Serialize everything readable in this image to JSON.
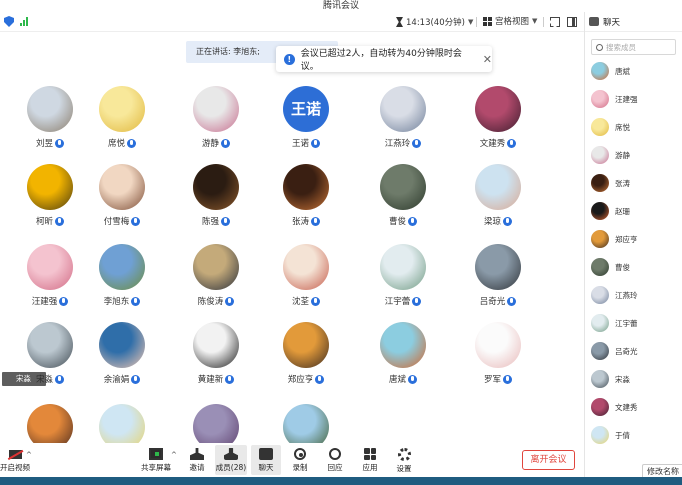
{
  "window": {
    "title": "腾讯会议"
  },
  "topbar": {
    "timer": "14:13(40分钟)",
    "view_label": "宫格视图"
  },
  "speaking": {
    "label": "正在讲话:",
    "speaker": "李旭东;"
  },
  "notice": {
    "text": "会议已超过2人，自动转为40分钟限时会议。",
    "close": "✕"
  },
  "grid": [
    {
      "name": "刘昱",
      "avatar": "photo",
      "colors": [
        "#cfd8e2",
        "#8a7d6b"
      ]
    },
    {
      "name": "席悦",
      "avatar": "photo",
      "colors": [
        "#f8e89a",
        "#e0b73d"
      ]
    },
    {
      "name": "游静",
      "avatar": "photo",
      "colors": [
        "#e8e8e8",
        "#c76c8d"
      ]
    },
    {
      "name": "王诺",
      "avatar": "text",
      "initials": "王诺",
      "host": true
    },
    {
      "name": "江燕玲",
      "avatar": "photo",
      "colors": [
        "#d9dde6",
        "#6f7f99"
      ]
    },
    {
      "name": "文建秀",
      "avatar": "photo",
      "colors": [
        "#b24a6c",
        "#3d1d2e"
      ]
    },
    {
      "name": "柯昕",
      "avatar": "photo",
      "colors": [
        "#f2b400",
        "#4a3a10"
      ]
    },
    {
      "name": "付雪梅",
      "avatar": "photo",
      "colors": [
        "#f1d7c2",
        "#7b4b34"
      ]
    },
    {
      "name": "陈强",
      "avatar": "photo",
      "colors": [
        "#2b1c12",
        "#8d5a2c"
      ]
    },
    {
      "name": "张涛",
      "avatar": "photo",
      "colors": [
        "#3a1f12",
        "#c87336"
      ]
    },
    {
      "name": "曹俊",
      "avatar": "photo",
      "colors": [
        "#6e7b6a",
        "#2d3a2c"
      ]
    },
    {
      "name": "梁琼",
      "avatar": "photo",
      "colors": [
        "#cde2f0",
        "#d9a892"
      ]
    },
    {
      "name": "汪建强",
      "avatar": "photo",
      "colors": [
        "#f4c3cf",
        "#d16a84"
      ]
    },
    {
      "name": "李旭东",
      "avatar": "photo",
      "colors": [
        "#6fa0d4",
        "#6e8d3c"
      ]
    },
    {
      "name": "陈俊涛",
      "avatar": "photo",
      "colors": [
        "#c4aa7a",
        "#2a2f3a"
      ]
    },
    {
      "name": "沈荃",
      "avatar": "photo",
      "colors": [
        "#f4e3d5",
        "#c55b4a"
      ]
    },
    {
      "name": "江宇蕾",
      "avatar": "photo",
      "colors": [
        "#e2ecef",
        "#6f9a82"
      ]
    },
    {
      "name": "吕奇光",
      "avatar": "photo",
      "colors": [
        "#8a9aa8",
        "#2f3338"
      ]
    },
    {
      "name": "宋淼",
      "avatar": "photo",
      "colors": [
        "#bcc8d0",
        "#404a52"
      ]
    },
    {
      "name": "余渝娟",
      "avatar": "photo",
      "colors": [
        "#2f6ea9",
        "#f0c7b2"
      ]
    },
    {
      "name": "黄建新",
      "avatar": "photo",
      "colors": [
        "#f2f2f2",
        "#1a1a1a"
      ]
    },
    {
      "name": "郑应亨",
      "avatar": "photo",
      "colors": [
        "#e29a3a",
        "#3b2a20"
      ]
    },
    {
      "name": "唐斌",
      "avatar": "photo",
      "colors": [
        "#8ccde0",
        "#d2652c"
      ]
    },
    {
      "name": "罗军",
      "avatar": "photo",
      "colors": [
        "#fbfbfb",
        "#e8b8b8"
      ]
    },
    {
      "name": "",
      "avatar": "photo",
      "colors": [
        "#e3883a",
        "#4a2a1e"
      ]
    },
    {
      "name": "",
      "avatar": "photo",
      "colors": [
        "#cfe6f3",
        "#e7d36a"
      ]
    },
    {
      "name": "",
      "avatar": "photo",
      "colors": [
        "#9a8fb6",
        "#5d3f6c"
      ]
    },
    {
      "name": "",
      "avatar": "photo",
      "colors": [
        "#9fcbe6",
        "#3e5b2e"
      ]
    }
  ],
  "self_tile": {
    "name": "宋淼"
  },
  "sidebar": {
    "header": "聊天",
    "search_placeholder": "搜索成员",
    "members": [
      {
        "name": "唐斌",
        "colors": [
          "#8ccde0",
          "#d2652c"
        ]
      },
      {
        "name": "汪建强",
        "colors": [
          "#f4c3cf",
          "#d16a84"
        ]
      },
      {
        "name": "席悦",
        "colors": [
          "#f8e89a",
          "#e0b73d"
        ]
      },
      {
        "name": "游静",
        "colors": [
          "#e8e8e8",
          "#c76c8d"
        ]
      },
      {
        "name": "张涛",
        "colors": [
          "#3a1f12",
          "#c87336"
        ]
      },
      {
        "name": "赵珊",
        "colors": [
          "#1a1a1a",
          "#d8622f"
        ]
      },
      {
        "name": "郑应亨",
        "colors": [
          "#e29a3a",
          "#3b2a20"
        ]
      },
      {
        "name": "曹俊",
        "colors": [
          "#6e7b6a",
          "#2d3a2c"
        ]
      },
      {
        "name": "江燕玲",
        "colors": [
          "#d9dde6",
          "#6f7f99"
        ]
      },
      {
        "name": "江宇蕾",
        "colors": [
          "#e2ecef",
          "#6f9a82"
        ]
      },
      {
        "name": "吕奇光",
        "colors": [
          "#8a9aa8",
          "#2f3338"
        ]
      },
      {
        "name": "宋淼",
        "colors": [
          "#bcc8d0",
          "#404a52"
        ]
      },
      {
        "name": "文建秀",
        "colors": [
          "#b24a6c",
          "#3d1d2e"
        ]
      },
      {
        "name": "于倩",
        "colors": [
          "#cfe6f3",
          "#e7d36a"
        ]
      }
    ],
    "edit_name": "修改名称"
  },
  "bottombar": {
    "camera": "开启视频",
    "share": "共享屏幕",
    "invite": "邀请",
    "members": "成员(28)",
    "chat": "聊天",
    "record": "录制",
    "react": "回应",
    "apps": "应用",
    "settings": "设置",
    "leave": "离开会议"
  }
}
